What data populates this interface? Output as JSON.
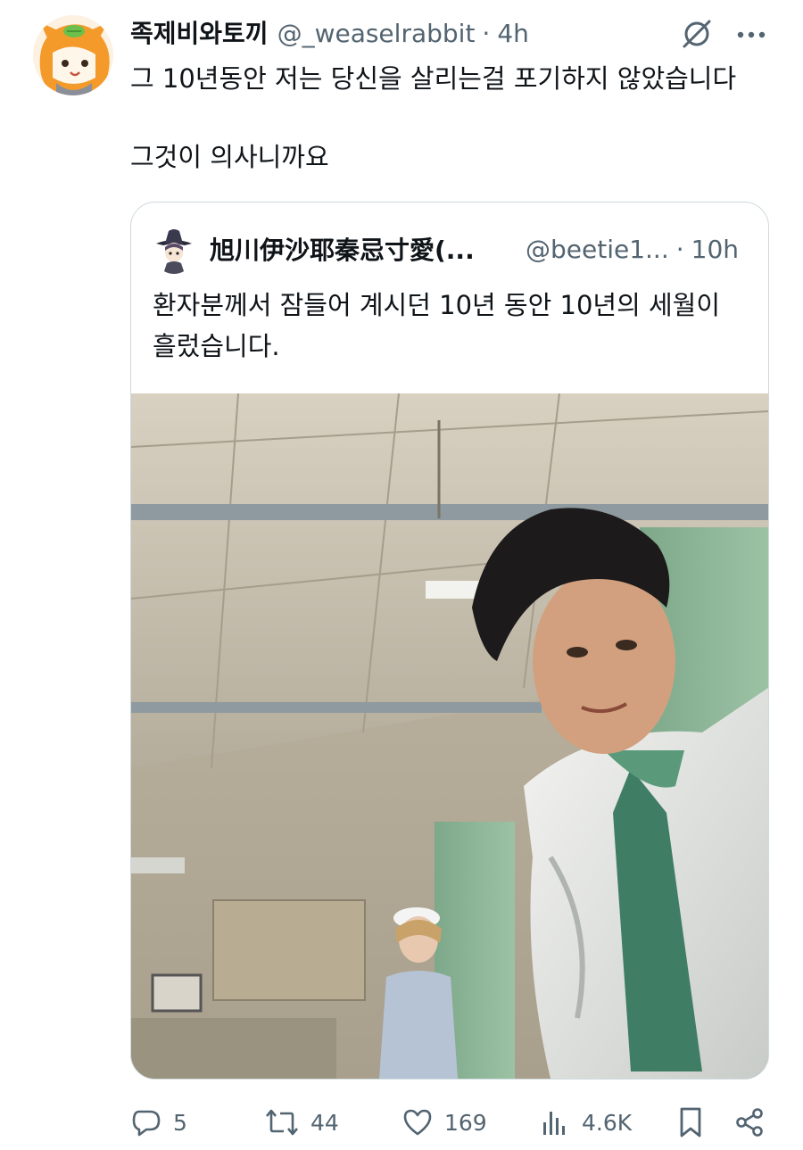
{
  "tweet": {
    "display_name": "족제비와토끼",
    "handle": "@_weaselrabbit",
    "separator": "·",
    "time": "4h",
    "text_line1": "그 10년동안 저는 당신을 살리는걸 포기하지 않았습니다",
    "text_line2": "그것이 의사니까요"
  },
  "quoted_tweet": {
    "display_name": "旭川伊沙耶秦忌寸愛(...",
    "handle": "@beetie1...",
    "separator": "·",
    "time": "10h",
    "text": "환자분께서 잠들어 계시던 10년 동안 10년의 세월이 흘렀습니다.",
    "media": "photo of a doctor in a white coat leaning toward the camera in a hospital room with a nurse in the background"
  },
  "actions": {
    "replies": "5",
    "reposts": "44",
    "likes": "169",
    "views": "4.6K"
  },
  "icons": {
    "grok": "grok-icon",
    "more": "more-icon",
    "reply": "reply-icon",
    "repost": "repost-icon",
    "like": "heart-icon",
    "views": "views-icon",
    "bookmark": "bookmark-icon",
    "share": "share-icon"
  },
  "colors": {
    "text": "#0f1419",
    "secondary": "#536471",
    "border": "#cfd9de"
  }
}
